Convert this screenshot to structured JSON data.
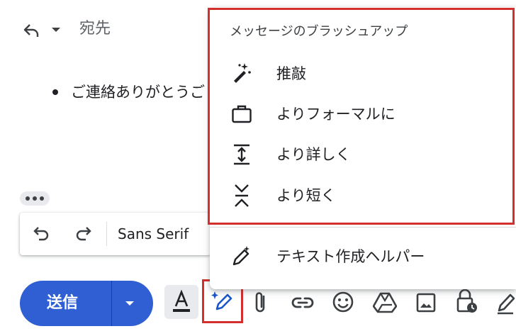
{
  "header": {
    "to_label": "宛先",
    "reply_icon": "reply-icon",
    "dropdown_icon": "caret-down-icon"
  },
  "body": {
    "first_line": "ご連絡ありがとうご"
  },
  "format_bar": {
    "undo_icon": "undo-icon",
    "redo_icon": "redo-icon",
    "font_name": "Sans Serif"
  },
  "compose": {
    "send_label": "送信",
    "send_options_icon": "caret-down-icon"
  },
  "menu": {
    "title": "メッセージのブラッシュアップ",
    "items": [
      {
        "label": "推敲",
        "icon": "magic-wand-icon"
      },
      {
        "label": "よりフォーマルに",
        "icon": "briefcase-icon"
      },
      {
        "label": "より詳しく",
        "icon": "expand-vertical-icon"
      },
      {
        "label": "より短く",
        "icon": "collapse-vertical-icon"
      }
    ],
    "footer_item": {
      "label": "テキスト作成ヘルパー",
      "icon": "pen-sparkle-icon"
    }
  },
  "toolbar": {
    "icons": [
      "text-color-icon",
      "pen-sparkle-icon",
      "attach-icon",
      "link-icon",
      "emoji-icon",
      "drive-icon",
      "photo-icon",
      "lock-clock-icon",
      "signature-icon"
    ]
  },
  "colors": {
    "accent": "#2f5fd3",
    "highlight": "#d32f2f"
  }
}
